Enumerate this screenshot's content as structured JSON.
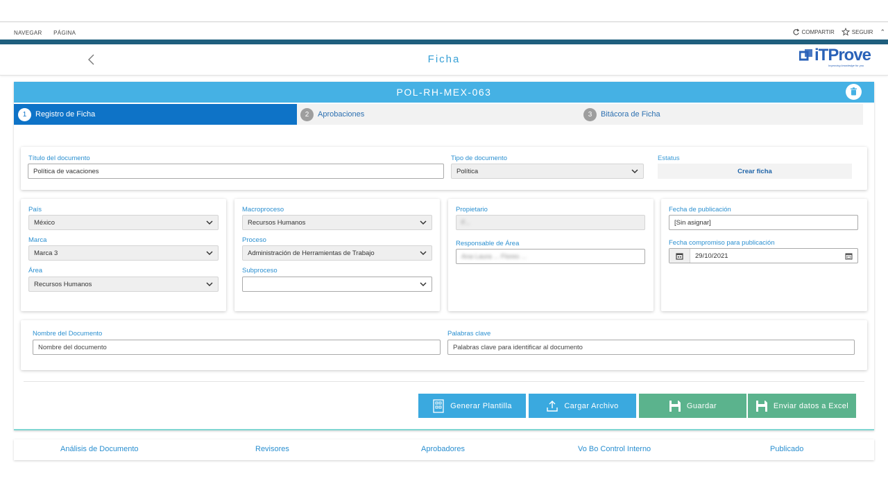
{
  "suitebar": {
    "nav_label": "NAVEGAR",
    "page_label": "PÁGINA",
    "share_label": "COMPARTIR",
    "follow_label": "SEGUIR"
  },
  "header": {
    "title": "Ficha",
    "logo_text": "iTProve",
    "logo_tagline": "Improving knowledge for you"
  },
  "record": {
    "code": "POL-RH-MEX-063",
    "tabs": [
      {
        "num": "1",
        "label": "Registro de Ficha"
      },
      {
        "num": "2",
        "label": "Aprobaciones"
      },
      {
        "num": "3",
        "label": "Bitácora de Ficha"
      }
    ]
  },
  "general": {
    "title_label": "Título del documento",
    "title_value": "Política de vacaciones",
    "type_label": "Tipo de documento",
    "type_value": "Política",
    "status_label": "Estatus",
    "status_value": "Crear ficha"
  },
  "classification": {
    "country_label": "País",
    "country_value": "México",
    "brand_label": "Marca",
    "brand_value": "Marca 3",
    "area_label": "Área",
    "area_value": "Recursos Humanos",
    "macroprocess_label": "Macroproceso",
    "macroprocess_value": "Recursos Humanos",
    "process_label": "Proceso",
    "process_value": "Administración de Herramientas de Trabajo",
    "subprocess_label": "Subproceso",
    "subprocess_value": ""
  },
  "owners": {
    "owner_label": "Propietario",
    "owner_value": "F...",
    "responsible_label": "Responsable de Área",
    "responsible_value": "Ana Laura ... Flores ..."
  },
  "dates": {
    "publish_label": "Fecha de publicación",
    "publish_value": "[Sin asignar]",
    "commit_label": "Fecha compromiso para publicación",
    "commit_value": "29/10/2021"
  },
  "document": {
    "name_label": "Nombre del Documento",
    "name_placeholder": "Nombre del documento",
    "keywords_label": "Palabras clave",
    "keywords_placeholder": "Palabras clave para identificar al documento"
  },
  "actions": {
    "generate": "Generar Plantilla",
    "upload": "Cargar Archivo",
    "save": "Guardar",
    "excel": "Enviar datos a Excel"
  },
  "workflow": [
    "Análisis de Documento",
    "Revisores",
    "Aprobadores",
    "Vo Bo Control Interno",
    "Publicado"
  ],
  "colors": {
    "primary": "#0e73c7",
    "code_bar": "#45b1e4",
    "blue_button": "#3aa9df",
    "green_button": "#5bb38d"
  }
}
